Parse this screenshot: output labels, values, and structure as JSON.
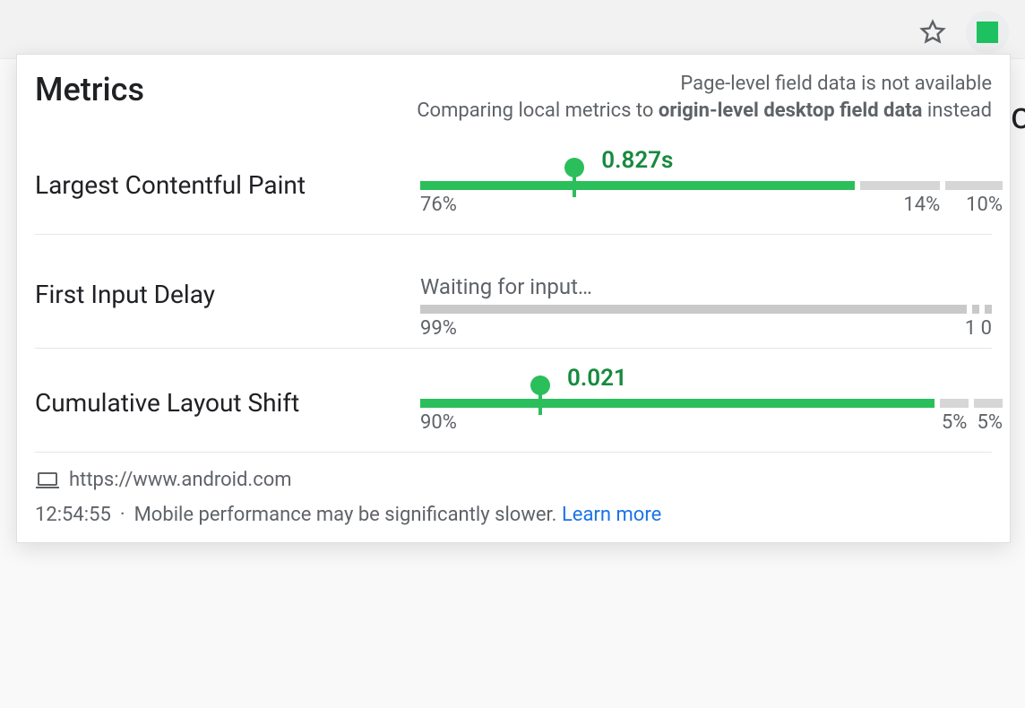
{
  "header": {
    "title": "Metrics",
    "note_line1": "Page-level field data is not available",
    "note_line2_prefix": "Comparing local metrics to ",
    "note_line2_bold": "origin-level desktop field data",
    "note_line2_suffix": " instead"
  },
  "metrics": {
    "lcp": {
      "label": "Largest Contentful Paint",
      "value": "0.827s",
      "value_pos_pct": 27,
      "marker_pos_pct": 27,
      "segments": {
        "good": 76,
        "ni": 14,
        "poor": 10
      },
      "pct_good": "76%",
      "pct_ni": "14%",
      "pct_poor": "10%"
    },
    "fid": {
      "label": "First Input Delay",
      "waiting": "Waiting for input…",
      "segments": {
        "good": 99,
        "ni": 1,
        "poor": 0
      },
      "pct_good": "99%",
      "pct_right": "1 0"
    },
    "cls": {
      "label": "Cumulative Layout Shift",
      "value": "0.021",
      "value_pos_pct": 21,
      "marker_pos_pct": 21,
      "segments": {
        "good": 90,
        "ni": 5,
        "poor": 5
      },
      "pct_good": "90%",
      "pct_ni": "5%",
      "pct_poor": "5%"
    }
  },
  "footer": {
    "url": "https://www.android.com",
    "time": "12:54:55",
    "note": "Mobile performance may be significantly slower.",
    "learn_more": "Learn more"
  },
  "colors": {
    "good": "#2bbf5b",
    "neutral": "#d6d6d6",
    "value": "#178a3e",
    "link": "#1a73e8"
  }
}
